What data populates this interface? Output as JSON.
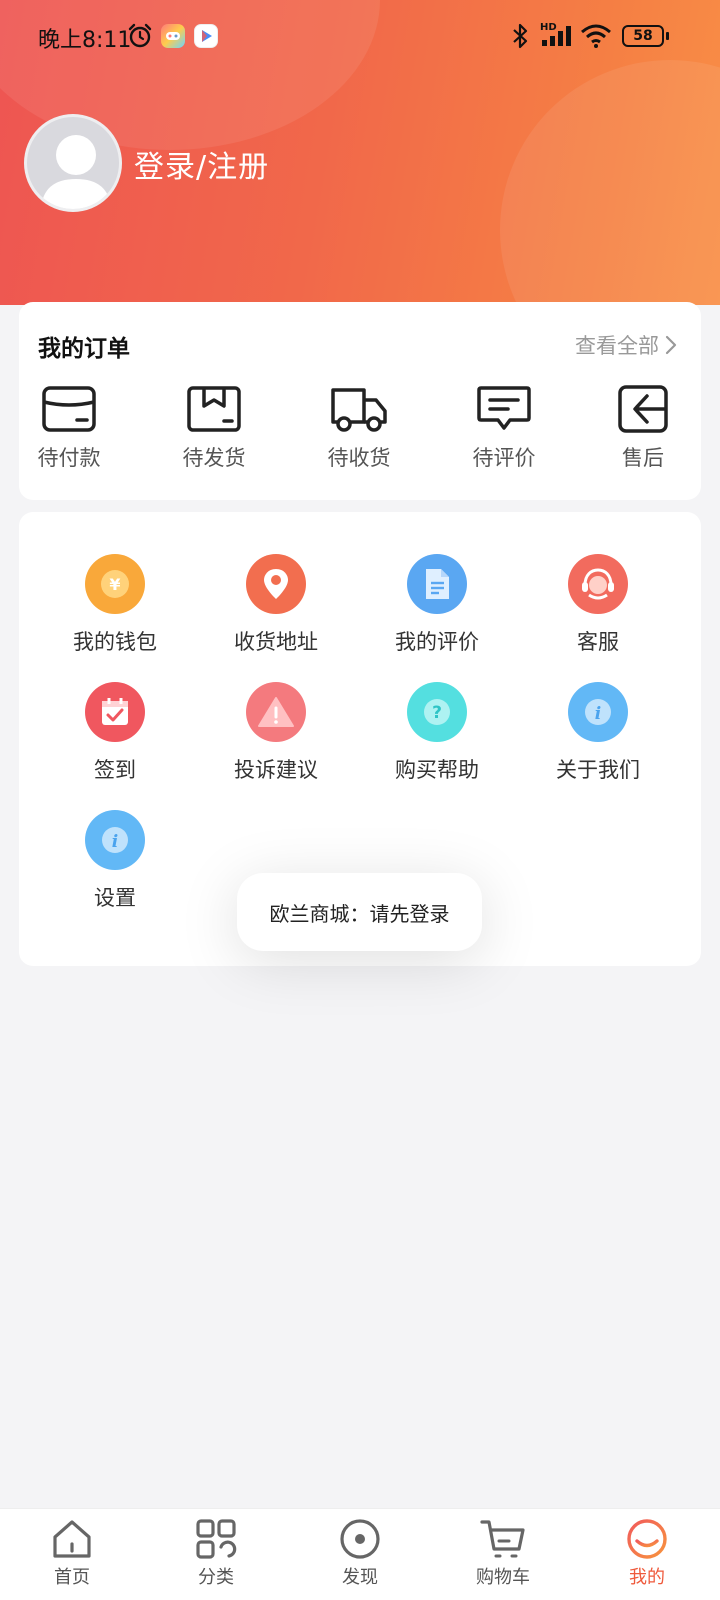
{
  "status_bar": {
    "time": "晚上8:11",
    "network_badge": "HD",
    "battery": "58"
  },
  "profile": {
    "login_label": "登录/注册"
  },
  "orders": {
    "title": "我的订单",
    "view_all": "查看全部",
    "items": [
      {
        "label": "待付款",
        "icon": "wallet-icon"
      },
      {
        "label": "待发货",
        "icon": "package-icon"
      },
      {
        "label": "待收货",
        "icon": "truck-icon"
      },
      {
        "label": "待评价",
        "icon": "comment-icon"
      },
      {
        "label": "售后",
        "icon": "return-icon"
      }
    ]
  },
  "services": {
    "items": [
      {
        "label": "我的钱包",
        "icon": "yen-coin-icon",
        "color": "#f9a83a"
      },
      {
        "label": "收货地址",
        "icon": "location-pin-icon",
        "color": "#f26e4f"
      },
      {
        "label": "我的评价",
        "icon": "document-icon",
        "color": "#5aa7f2"
      },
      {
        "label": "客服",
        "icon": "headset-icon",
        "color": "#f26b5e"
      },
      {
        "label": "签到",
        "icon": "calendar-check-icon",
        "color": "#f0575f"
      },
      {
        "label": "投诉建议",
        "icon": "warning-icon",
        "color": "#f47a7e"
      },
      {
        "label": "购买帮助",
        "icon": "question-icon",
        "color": "#54dfe0"
      },
      {
        "label": "关于我们",
        "icon": "info-icon",
        "color": "#62b8f6"
      },
      {
        "label": "设置",
        "icon": "info-icon",
        "color": "#62b8f6"
      }
    ]
  },
  "toast": {
    "message": "欧兰商城：请先登录"
  },
  "tabbar": {
    "active_color": "#ef5a3c",
    "items": [
      {
        "label": "首页",
        "icon": "home-icon"
      },
      {
        "label": "分类",
        "icon": "category-icon"
      },
      {
        "label": "发现",
        "icon": "discover-icon"
      },
      {
        "label": "购物车",
        "icon": "cart-icon"
      },
      {
        "label": "我的",
        "icon": "profile-smile-icon"
      }
    ]
  }
}
